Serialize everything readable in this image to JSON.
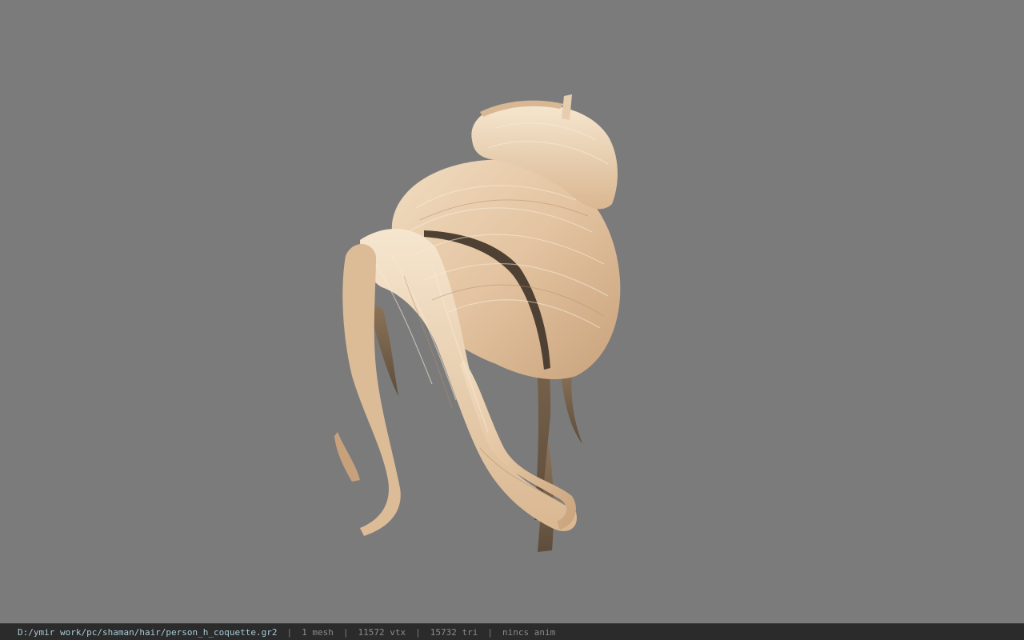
{
  "viewer": {
    "background_color": "#7b7b7b",
    "model_semantic": "blonde-hair-bun-model"
  },
  "statusbar": {
    "file_path": "D:/ymir work/pc/shaman/hair/person_h_coquette.gr2",
    "separator": "|",
    "mesh_count": "1 mesh",
    "vertex_count": "11572 vtx",
    "triangle_count": "15732 tri",
    "anim_status": "nincs anim",
    "path_color": "#a9c9d6",
    "text_color": "#8a8a8a",
    "bar_color": "#2b2b2b"
  }
}
